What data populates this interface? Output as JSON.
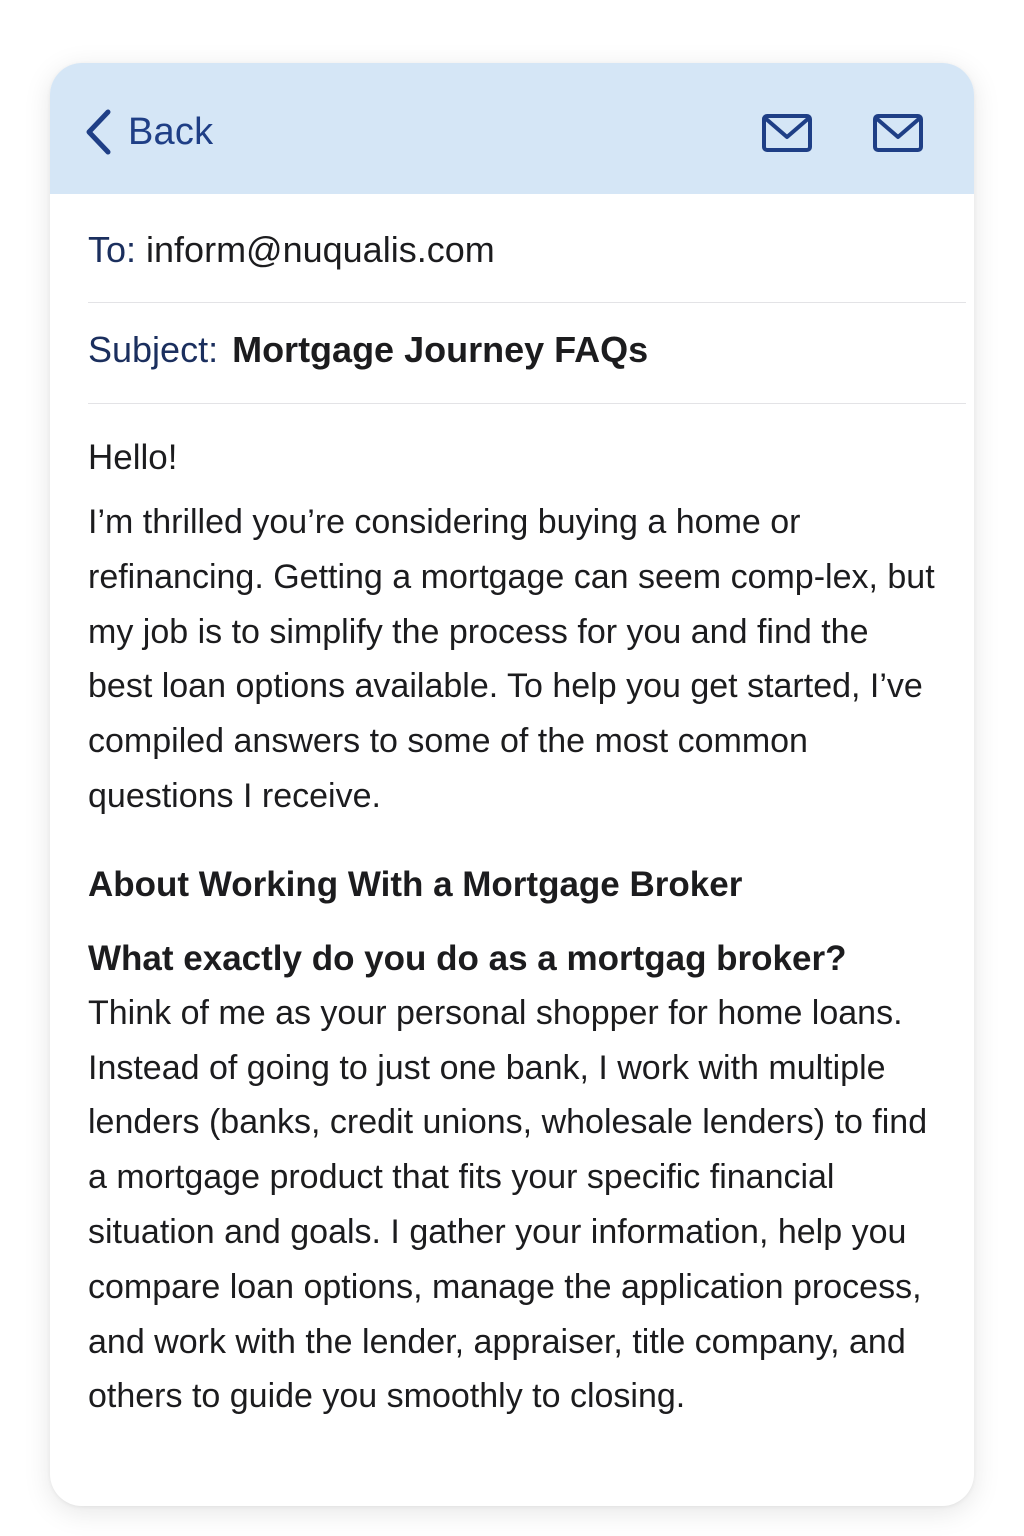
{
  "header": {
    "back_label": "Back",
    "accent_color": "#1f3f86",
    "background_color": "#d5e6f6",
    "icons": [
      "chevron-left-icon",
      "mail-icon",
      "mail-icon"
    ]
  },
  "email": {
    "to_label": "To:",
    "to_value": "inform@nuqualis.com",
    "subject_label": "Subject:",
    "subject_value": "Mortgage Journey FAQs"
  },
  "body": {
    "greeting": "Hello!",
    "intro": "I’m thrilled you’re considering buying a home or refinancing. Getting a mortgage can seem comp-lex, but my job is to simplify the process for you and find the best loan options available. To help you get started, I’ve compiled answers to some of the most common questions I receive.",
    "section_heading": "About Working With a Mortgage Broker",
    "question": "What exactly do you do as a mortgag broker?",
    "answer": "Think of me as your personal shopper for home loans. Instead of going to just one bank, I work with multiple lenders (banks, credit unions, wholesale lenders) to find a mortgage product that fits your specific financial situation and goals. I gather your information, help you compare loan options, manage the application process, and work with the lender, appraiser, title company, and others to guide you smoothly to closing."
  }
}
